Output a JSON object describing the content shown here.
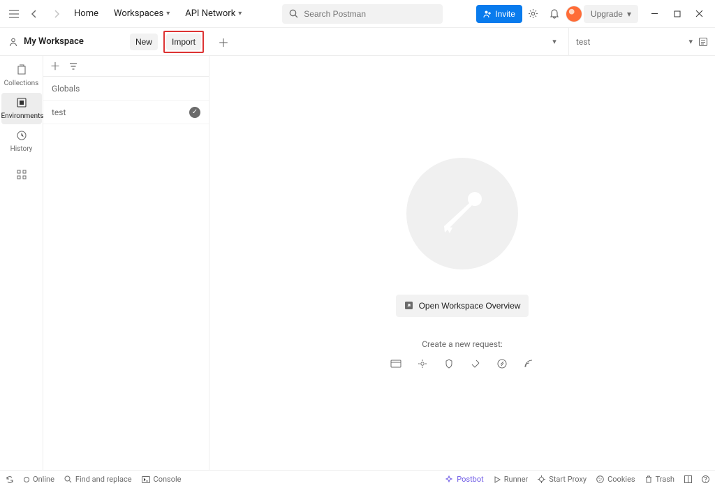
{
  "topbar": {
    "home": "Home",
    "workspaces": "Workspaces",
    "api_network": "API Network",
    "search_placeholder": "Search Postman",
    "invite": "Invite",
    "upgrade": "Upgrade"
  },
  "workspace": {
    "title": "My Workspace",
    "new": "New",
    "import": "Import",
    "env_selector": "test"
  },
  "rail": {
    "collections": "Collections",
    "environments": "Environments",
    "history": "History"
  },
  "env_list": {
    "globals": "Globals",
    "items": [
      {
        "name": "test",
        "active": true
      }
    ]
  },
  "main": {
    "open_overview": "Open Workspace Overview",
    "create_label": "Create a new request:"
  },
  "status": {
    "online": "Online",
    "find_replace": "Find and replace",
    "console": "Console",
    "postbot": "Postbot",
    "runner": "Runner",
    "start_proxy": "Start Proxy",
    "cookies": "Cookies",
    "trash": "Trash"
  }
}
